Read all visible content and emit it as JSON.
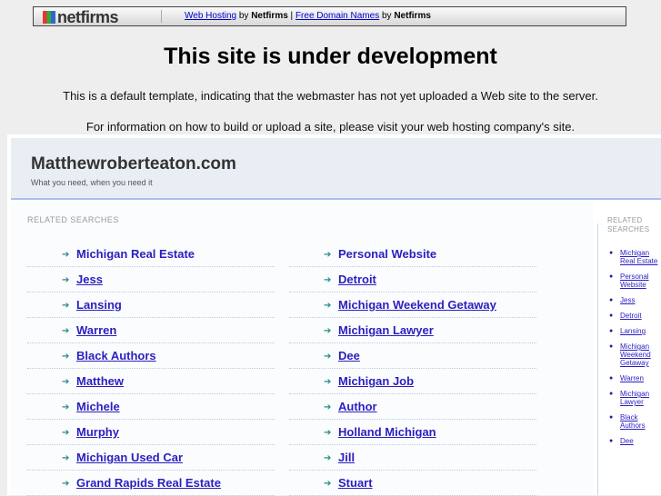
{
  "banner": {
    "logo": "netfirms",
    "link1": "Web Hosting",
    "by1": " by ",
    "brand1": "Netfirms",
    "pipe": " | ",
    "link2": "Free Domain Names",
    "by2": " by ",
    "brand2": "Netfirms"
  },
  "title": "This site is under development",
  "para1": "This is a default template, indicating that the webmaster has not yet uploaded a Web site to the server.",
  "para2": "For information on how to build or upload a site, please visit your web hosting company's site.",
  "parked": {
    "site": "Matthewroberteaton.com",
    "tagline": "What you need, when you need it",
    "related_label": "RELATED SEARCHES",
    "side_label": "RELATED SEARCHES",
    "left": [
      "Michigan Real Estate",
      "Jess",
      "Lansing",
      "Warren",
      "Black Authors",
      "Matthew",
      "Michele",
      "Murphy",
      "Michigan Used Car",
      "Grand Rapids Real Estate"
    ],
    "right": [
      "Personal Website",
      "Detroit",
      "Michigan Weekend Getaway",
      "Michigan Lawyer",
      "Dee",
      "Michigan Job",
      "Author",
      "Holland Michigan",
      "Jill",
      "Stuart"
    ],
    "side": [
      "Michigan Real Estate",
      "Personal Website",
      "Jess",
      "Detroit",
      "Lansing",
      "Michigan Weekend Getaway",
      "Warren",
      "Michigan Lawyer",
      "Black Authors",
      "Dee"
    ]
  }
}
